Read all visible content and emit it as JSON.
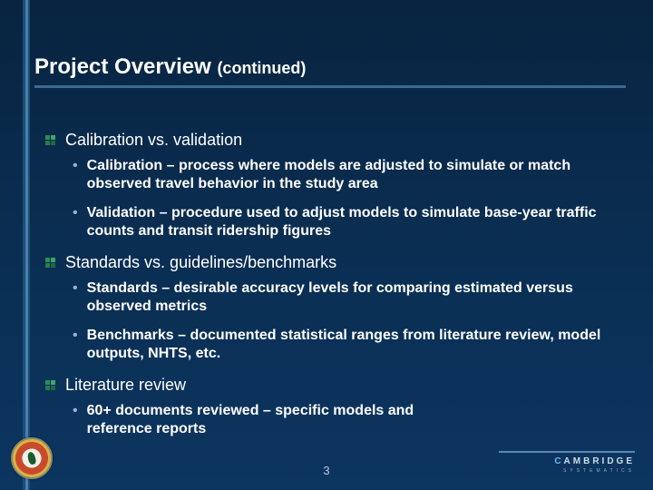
{
  "title_main": "Project Overview",
  "title_suffix": "(continued)",
  "bullets": [
    {
      "text": "Calibration vs. validation",
      "sub": [
        "Calibration – process where models are adjusted to simulate or match observed travel behavior in the study area",
        "Validation – procedure used to adjust models to simulate base-year traffic counts and transit ridership figures"
      ]
    },
    {
      "text": "Standards vs. guidelines/benchmarks",
      "sub": [
        "Standards – desirable accuracy levels for comparing estimated versus observed metrics",
        "Benchmarks – documented statistical ranges from literature review, model outputs, NHTS, etc."
      ]
    },
    {
      "text": "Literature review",
      "sub": [
        "60+ documents reviewed – specific models and reference reports"
      ]
    }
  ],
  "page_number": "3",
  "brand_primary": "CAMBRIDGE",
  "brand_sub": "SYSTEMATICS"
}
